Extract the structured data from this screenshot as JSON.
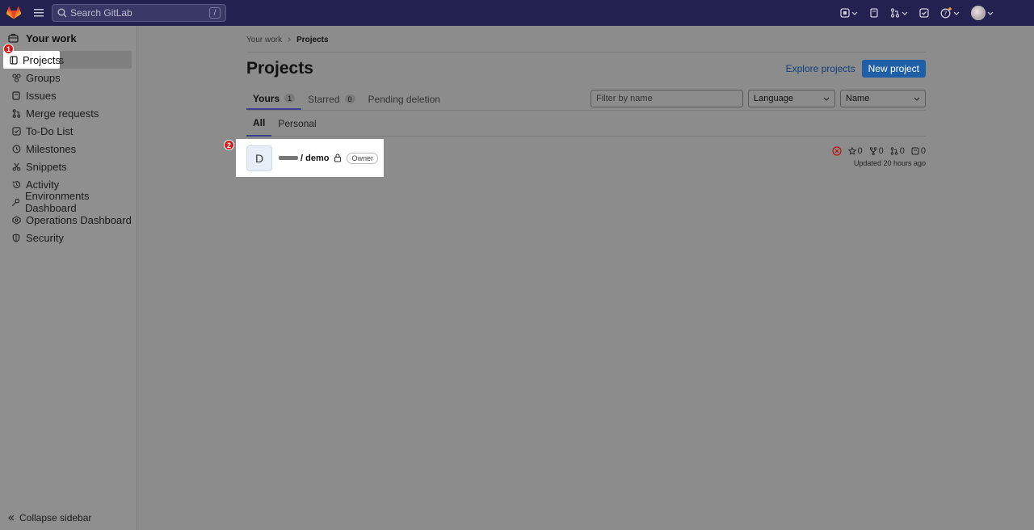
{
  "topbar": {
    "search_placeholder": "Search GitLab",
    "search_shortcut": "/",
    "brand_color": "#fc6d26"
  },
  "sidebar": {
    "header": "Your work",
    "items": [
      {
        "label": "Projects",
        "icon": "project-icon"
      },
      {
        "label": "Groups",
        "icon": "group-icon"
      },
      {
        "label": "Issues",
        "icon": "issues-icon"
      },
      {
        "label": "Merge requests",
        "icon": "merge-request-icon"
      },
      {
        "label": "To-Do List",
        "icon": "todo-icon"
      },
      {
        "label": "Milestones",
        "icon": "milestone-icon"
      },
      {
        "label": "Snippets",
        "icon": "snippet-icon"
      },
      {
        "label": "Activity",
        "icon": "history-icon"
      },
      {
        "label": "Environments Dashboard",
        "icon": "environment-icon"
      },
      {
        "label": "Operations Dashboard",
        "icon": "operations-icon"
      },
      {
        "label": "Security",
        "icon": "shield-icon"
      }
    ],
    "collapse_label": "Collapse sidebar"
  },
  "annotations": {
    "step1": "1",
    "step2": "2"
  },
  "main": {
    "breadcrumb": {
      "parent": "Your work",
      "current": "Projects"
    },
    "title": "Projects",
    "explore_label": "Explore projects",
    "new_project_label": "New project",
    "tabs": [
      {
        "label": "Yours",
        "count": "1"
      },
      {
        "label": "Starred",
        "count": "0"
      },
      {
        "label": "Pending deletion"
      }
    ],
    "filter_placeholder": "Filter by name",
    "language_select": "Language",
    "sort_select": "Name",
    "subtabs": [
      "All",
      "Personal"
    ],
    "project": {
      "avatar_letter": "D",
      "name": "/ demo",
      "role": "Owner",
      "stars": "0",
      "forks": "0",
      "merge_requests": "0",
      "issues": "0",
      "updated": "Updated 20 hours ago"
    }
  }
}
